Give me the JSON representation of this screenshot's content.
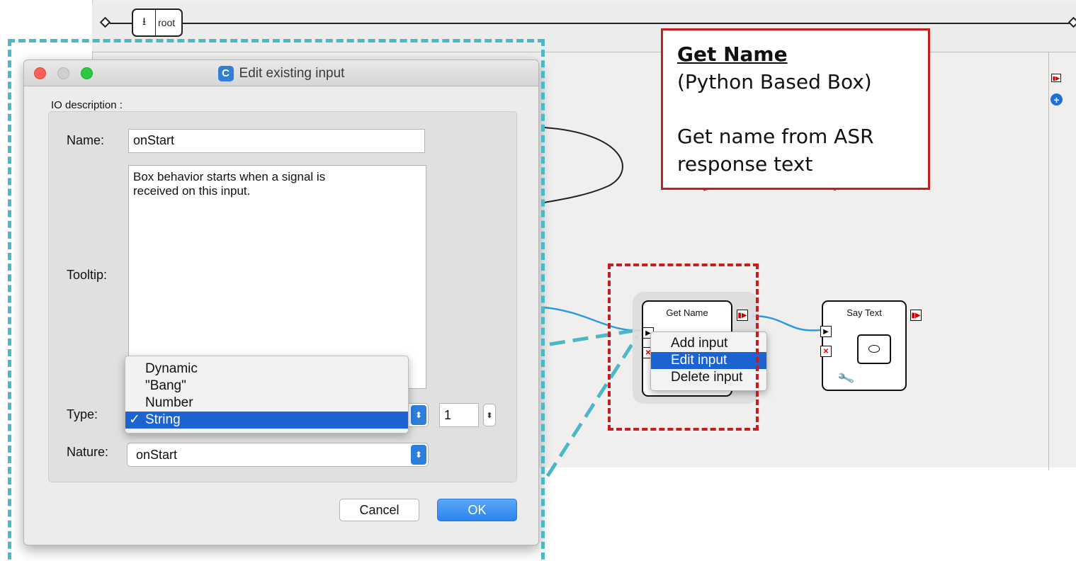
{
  "breadcrumb": {
    "root_label": "root"
  },
  "callout": {
    "title": "Get Name",
    "subtitle": "(Python Based Box)",
    "desc_line1": "Get name from ASR",
    "desc_line2": "response text"
  },
  "boxes": {
    "get_name": {
      "title": "Get Name"
    },
    "say_text": {
      "title": "Say Text"
    }
  },
  "context_menu": {
    "items": [
      "Add input",
      "Edit input",
      "Delete input"
    ],
    "selected": "Edit input"
  },
  "dialog": {
    "title": "Edit existing input",
    "app_icon_letter": "C",
    "group_label": "IO description :",
    "name_label": "Name:",
    "name_value": "onStart",
    "tooltip_label": "Tooltip:",
    "tooltip_line1": "Box behavior starts when a signal is",
    "tooltip_line2": "received on this input.",
    "type_label": "Type:",
    "type_options": [
      "Dynamic",
      "\"Bang\"",
      "Number",
      "String"
    ],
    "type_selected": "String",
    "size_value": "1",
    "nature_label": "Nature:",
    "nature_value": "onStart",
    "cancel_label": "Cancel",
    "ok_label": "OK"
  },
  "colors": {
    "callout_border": "#c41e1e",
    "highlight_red": "#c41e1e",
    "highlight_teal": "#4bb7c8",
    "selection_blue": "#1c63d2",
    "link_blue": "#2a9be0"
  },
  "icons": [
    "import-arrow-icon",
    "play-input-icon",
    "stop-input-icon",
    "output-port-icon",
    "speech-bubble-icon",
    "wrench-icon",
    "add-circle-icon",
    "checkmark-icon",
    "updown-arrows-icon"
  ]
}
